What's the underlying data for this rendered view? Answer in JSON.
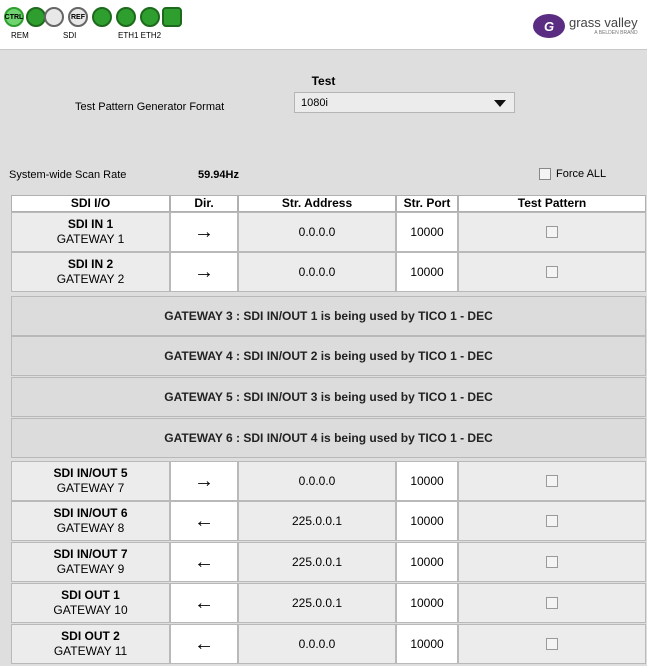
{
  "toolbar": {
    "icons": [
      {
        "text": "CTRL",
        "name": "ctrl-status-icon"
      },
      {
        "text": "",
        "name": "connection-status-icon"
      },
      {
        "text": "",
        "name": "sdi-status-icon"
      },
      {
        "text": "REF",
        "name": "ref-status-icon"
      },
      {
        "text": "",
        "name": "eth1-status-icon"
      },
      {
        "text": "",
        "name": "eth2-status-icon"
      },
      {
        "text": "",
        "name": "plus-status-icon"
      },
      {
        "text": "",
        "name": "transfer-status-icon"
      }
    ],
    "captions": [
      "REM",
      "SDI",
      "ETH1 ETH2"
    ],
    "logo": {
      "main": "grass valley",
      "sub": "A BELDEN BRAND"
    }
  },
  "page": {
    "title": "Test",
    "format_label": "Test Pattern Generator Format",
    "format_value": "1080i",
    "scan_rate_label": "System-wide Scan Rate",
    "scan_rate_value": "59.94Hz",
    "force_all_label": "Force ALL"
  },
  "table": {
    "headers": [
      "SDI I/O",
      "Dir.",
      "Str. Address",
      "Str. Port",
      "Test Pattern"
    ],
    "rows_top": [
      {
        "io": "SDI IN 1",
        "gateway": "GATEWAY 1",
        "dir": "→",
        "address": "0.0.0.0",
        "port": "10000"
      },
      {
        "io": "SDI IN 2",
        "gateway": "GATEWAY 2",
        "dir": "→",
        "address": "0.0.0.0",
        "port": "10000"
      }
    ],
    "banners": [
      "GATEWAY 3 : SDI IN/OUT 1 is being used by TICO 1 - DEC",
      "GATEWAY 4 : SDI IN/OUT 2 is being used by TICO 1 - DEC",
      "GATEWAY 5 : SDI IN/OUT 3 is being used by TICO 1 - DEC",
      "GATEWAY 6 : SDI IN/OUT 4 is being used by TICO 1 - DEC"
    ],
    "rows_bottom": [
      {
        "io": "SDI IN/OUT 5",
        "gateway": "GATEWAY 7",
        "dir": "→",
        "address": "0.0.0.0",
        "port": "10000"
      },
      {
        "io": "SDI IN/OUT 6",
        "gateway": "GATEWAY 8",
        "dir": "←",
        "address": "225.0.0.1",
        "port": "10000"
      },
      {
        "io": "SDI IN/OUT 7",
        "gateway": "GATEWAY 9",
        "dir": "←",
        "address": "225.0.0.1",
        "port": "10000"
      },
      {
        "io": "SDI OUT 1",
        "gateway": "GATEWAY 10",
        "dir": "←",
        "address": "225.0.0.1",
        "port": "10000"
      },
      {
        "io": "SDI OUT 2",
        "gateway": "GATEWAY 11",
        "dir": "←",
        "address": "0.0.0.0",
        "port": "10000"
      }
    ]
  }
}
